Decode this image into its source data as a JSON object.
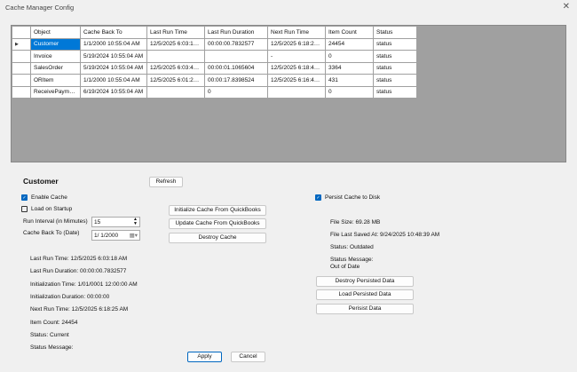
{
  "window": {
    "title": "Cache Manager Config",
    "close_icon": "close-icon"
  },
  "grid": {
    "columns": [
      "Object",
      "Cache Back To",
      "Last Run Time",
      "Last Run Duration",
      "Next Run Time",
      "Item Count",
      "Status"
    ],
    "rows": [
      [
        "Customer",
        "1/1/2000 10:55:04 AM",
        "12/5/2025 6:03:18 A...",
        "00:00:00.7832577",
        "12/5/2025 6:18:25 A...",
        "24454",
        "status"
      ],
      [
        "Invoice",
        "5/19/2024 10:55:04 AM",
        "",
        "",
        "-",
        "0",
        "status"
      ],
      [
        "SalesOrder",
        "5/19/2024 10:55:04 AM",
        "12/5/2025 6:03:40 A...",
        "00:00:01.1065604",
        "12/5/2025 6:18:43 A...",
        "3364",
        "status"
      ],
      [
        "ORItem",
        "1/1/2000 10:55:04 AM",
        "12/5/2025 6:01:23 A...",
        "00:00:17.8398524",
        "12/5/2025 6:16:41 A...",
        "431",
        "status"
      ],
      [
        "ReceivePayment",
        "6/19/2024 10:55:04 AM",
        "",
        "0",
        "",
        "0",
        "status"
      ]
    ]
  },
  "detail": {
    "heading": "Customer",
    "refresh": "Refresh",
    "enable_cache": "Enable Cache",
    "enable_cache_checked": true,
    "load_on_startup": "Load on Startup",
    "load_on_startup_checked": false,
    "run_interval_label": "Run Interval (in Mimutes)",
    "run_interval_value": "15",
    "cache_back_label": "Cache Back To (Date)",
    "cache_back_value": "1/  1/2000",
    "init_btn": "Initialize Cache From QuickBooks",
    "update_btn": "Update Cache From QuickBooks",
    "destroy_btn": "Destroy Cache",
    "info": [
      "Last Run Time: 12/5/2025 6:03:18 AM",
      "Last Run Duration: 00:00:00.7832577",
      "Initialization Time: 1/01/0001 12:00:00 AM",
      "Initialization Duration: 00:00:00",
      "Next Run Time: 12/5/2025 6:18:25 AM",
      "Item Count: 24454",
      "Status: Current",
      "Status Message:"
    ],
    "persist": "Persist Cache to Disk",
    "persist_checked": true,
    "file_size": "File Size: 69.28 MB",
    "file_saved": "File Last Saved At: 9/24/2025 10:48:39 AM",
    "persist_status": "Status: Outdated",
    "persist_msg_label": "Status Message:",
    "persist_msg": "Out of Date",
    "destroy_persisted": "Destroy Persisted Data",
    "load_persisted": "Load Persisted Data",
    "persist_data": "Perisist Data",
    "apply": "Apply",
    "cancel": "Cancel"
  }
}
